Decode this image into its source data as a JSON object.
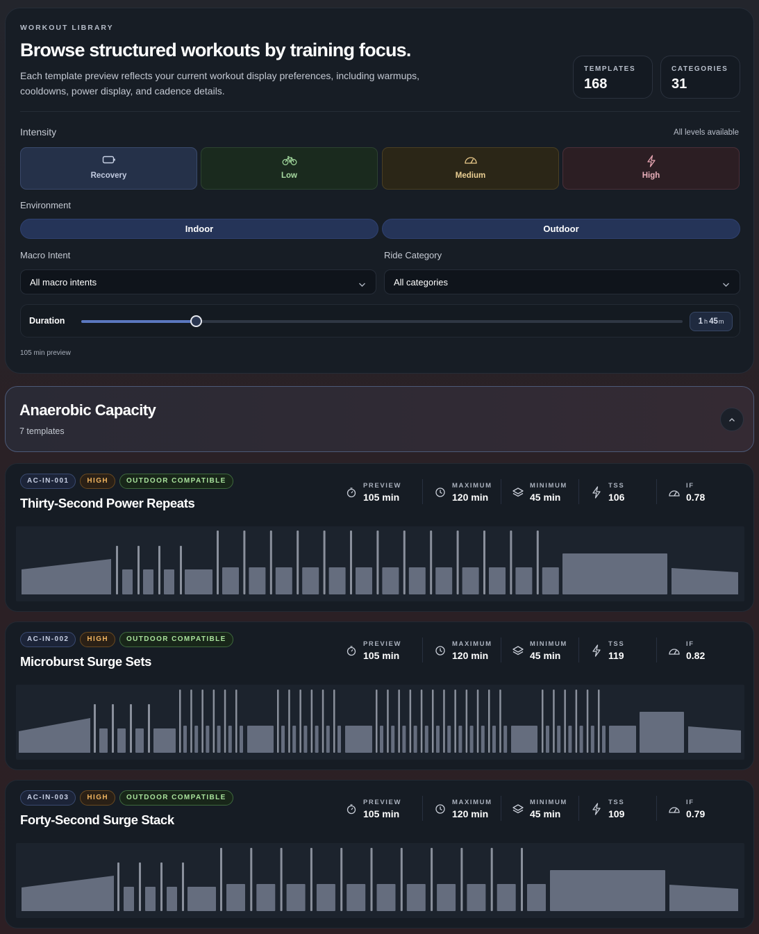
{
  "header": {
    "eyebrow": "WORKOUT LIBRARY",
    "title": "Browse structured workouts by training focus.",
    "description": "Each template preview reflects your current workout display preferences, including warmups, cooldowns, power display, and cadence details."
  },
  "stats": [
    {
      "label": "TEMPLATES",
      "value": "168"
    },
    {
      "label": "CATEGORIES",
      "value": "31"
    }
  ],
  "intensity": {
    "label": "Intensity",
    "note": "All levels available",
    "options": [
      {
        "label": "Recovery",
        "icon": "battery-icon"
      },
      {
        "label": "Low",
        "icon": "bicycle-icon"
      },
      {
        "label": "Medium",
        "icon": "gauge-icon"
      },
      {
        "label": "High",
        "icon": "lightning-icon"
      }
    ]
  },
  "environment": {
    "label": "Environment",
    "options": [
      "Indoor",
      "Outdoor"
    ]
  },
  "filters": {
    "macro_label": "Macro Intent",
    "macro_value": "All macro intents",
    "ride_label": "Ride Category",
    "ride_value": "All categories"
  },
  "duration": {
    "label": "Duration",
    "value_h": "1",
    "unit_h": "h",
    "value_m": "45",
    "unit_m": "m",
    "fraction": 0.19,
    "note": "105 min preview"
  },
  "category": {
    "name": "Anaerobic Capacity",
    "count": "7 templates",
    "expanded": true
  },
  "metric_labels": [
    "PREVIEW",
    "MAXIMUM",
    "MINIMUM",
    "TSS",
    "IF"
  ],
  "workouts": [
    {
      "id": "AC-IN-001",
      "level": "HIGH",
      "compat": "OUTDOOR COMPATIBLE",
      "title": "Thirty-Second Power Repeats",
      "metrics": [
        "105 min",
        "120 min",
        "45 min",
        "106",
        "0.78"
      ]
    },
    {
      "id": "AC-IN-002",
      "level": "HIGH",
      "compat": "OUTDOOR COMPATIBLE",
      "title": "Microburst Surge Sets",
      "metrics": [
        "105 min",
        "120 min",
        "45 min",
        "119",
        "0.82"
      ]
    },
    {
      "id": "AC-IN-003",
      "level": "HIGH",
      "compat": "OUTDOOR COMPATIBLE",
      "title": "Forty-Second Surge Stack",
      "metrics": [
        "105 min",
        "120 min",
        "45 min",
        "109",
        "0.79"
      ]
    }
  ],
  "colors": {
    "recovery": "#253149",
    "low": "#1a2a1e",
    "medium": "#2b2617",
    "high": "#2c1e23",
    "bar": "#656d7e",
    "spike": "#8a909c"
  }
}
